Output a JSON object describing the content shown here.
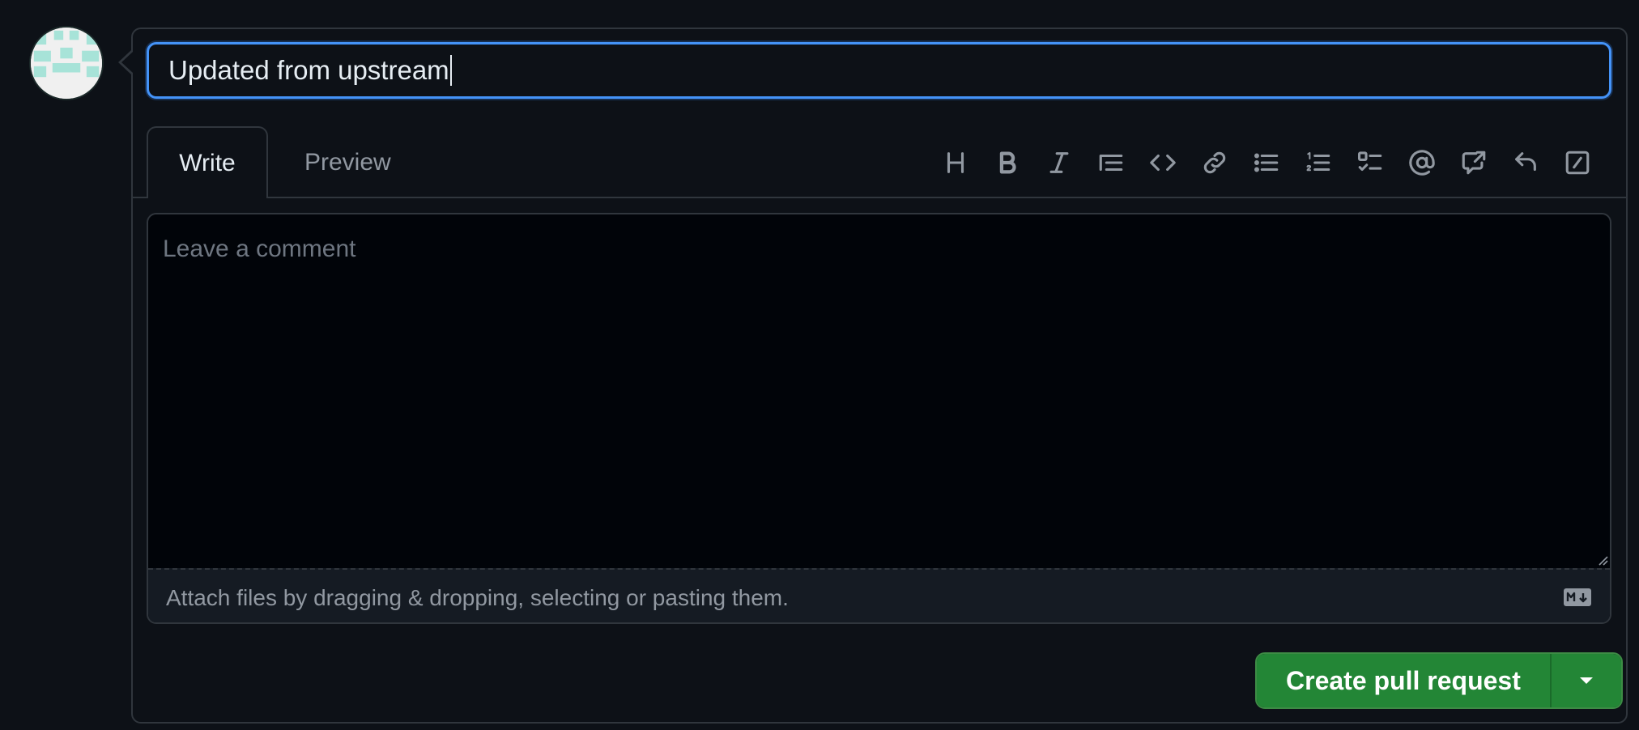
{
  "title_input": {
    "value": "Updated from upstream"
  },
  "tabs": {
    "write": "Write",
    "preview": "Preview"
  },
  "toolbar": {
    "items": [
      "heading-icon",
      "bold-icon",
      "italic-icon",
      "quote-icon",
      "code-icon",
      "link-icon",
      "unordered-list-icon",
      "ordered-list-icon",
      "task-list-icon",
      "mention-icon",
      "reference-icon",
      "undo-icon",
      "slash-command-icon"
    ]
  },
  "editor": {
    "placeholder": "Leave a comment",
    "attach_text": "Attach files by dragging & dropping, selecting or pasting them."
  },
  "actions": {
    "create_label": "Create pull request"
  },
  "colors": {
    "background": "#0d1117",
    "focus_border": "#4493f8",
    "primary_button": "#238636",
    "muted_text": "#9198a1"
  }
}
